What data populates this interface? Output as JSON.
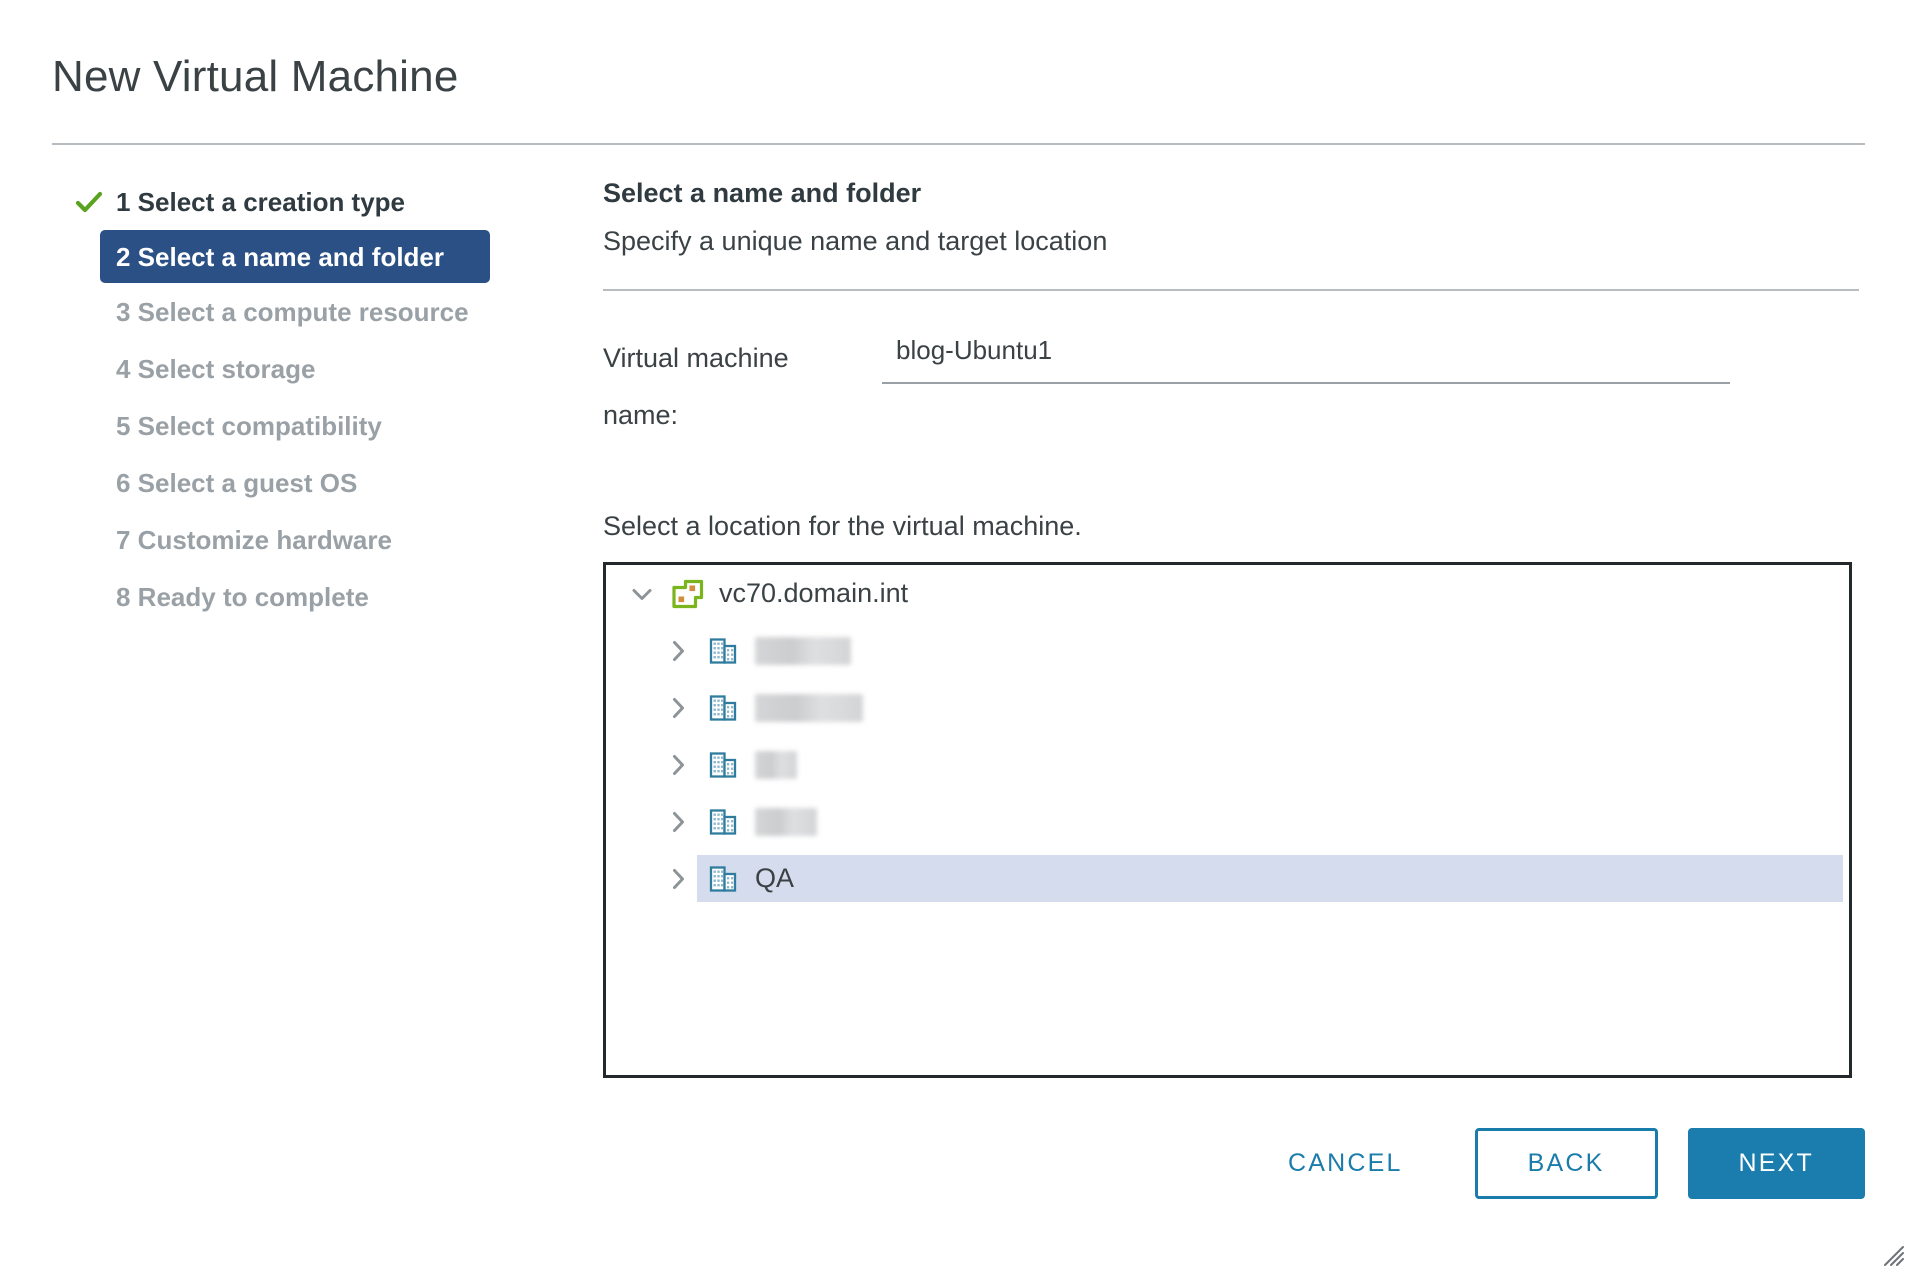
{
  "window": {
    "title": "New Virtual Machine",
    "resize_grip_icon": "resize-grip-icon"
  },
  "steps": [
    {
      "number": "1",
      "label": "1 Select a creation type",
      "state": "done",
      "icon": "check-icon"
    },
    {
      "number": "2",
      "label": "2 Select a name and folder",
      "state": "active"
    },
    {
      "number": "3",
      "label": "3 Select a compute resource",
      "state": "pending"
    },
    {
      "number": "4",
      "label": "4 Select storage",
      "state": "pending"
    },
    {
      "number": "5",
      "label": "5 Select compatibility",
      "state": "pending"
    },
    {
      "number": "6",
      "label": "6 Select a guest OS",
      "state": "pending"
    },
    {
      "number": "7",
      "label": "7 Customize hardware",
      "state": "pending"
    },
    {
      "number": "8",
      "label": "8 Ready to complete",
      "state": "pending"
    }
  ],
  "pane": {
    "heading": "Select a name and folder",
    "subheading": "Specify a unique name and target location"
  },
  "name_field": {
    "label": "Virtual machine name:",
    "value": "blog-Ubuntu1",
    "placeholder": ""
  },
  "location": {
    "prompt": "Select a location for the virtual machine.",
    "tree": [
      {
        "label": "vc70.domain.int",
        "level": 0,
        "expanded": true,
        "twisty": "chevron-down-icon",
        "icon": "vcenter-server-icon",
        "selected": false,
        "redacted": false
      },
      {
        "label": "",
        "level": 1,
        "expanded": false,
        "twisty": "chevron-right-icon",
        "icon": "datacenter-icon",
        "selected": false,
        "redacted": true,
        "redacted_width": 96
      },
      {
        "label": "",
        "level": 1,
        "expanded": false,
        "twisty": "chevron-right-icon",
        "icon": "datacenter-icon",
        "selected": false,
        "redacted": true,
        "redacted_width": 108
      },
      {
        "label": "",
        "level": 1,
        "expanded": false,
        "twisty": "chevron-right-icon",
        "icon": "datacenter-icon",
        "selected": false,
        "redacted": true,
        "redacted_width": 42
      },
      {
        "label": "",
        "level": 1,
        "expanded": false,
        "twisty": "chevron-right-icon",
        "icon": "datacenter-icon",
        "selected": false,
        "redacted": true,
        "redacted_width": 62
      },
      {
        "label": "QA",
        "level": 1,
        "expanded": false,
        "twisty": "chevron-right-icon",
        "icon": "datacenter-icon",
        "selected": true,
        "redacted": false
      }
    ]
  },
  "footer": {
    "cancel_label": "CANCEL",
    "back_label": "BACK",
    "next_label": "NEXT"
  },
  "colors": {
    "active_step_bg": "#2a5085",
    "primary_button_bg": "#1a7dad",
    "link_text": "#1a7cab",
    "selected_row_bg": "#d5dced",
    "check_green": "#5aa320",
    "vcenter_icon_green": "#7ab51d",
    "vcenter_icon_accent": "#d28e3d",
    "datacenter_icon_blue": "#2f7c9e",
    "body_text": "#3b4245",
    "muted_text": "#9aa1a6",
    "rule": "#b7bdc0",
    "tree_border": "#22282b"
  }
}
